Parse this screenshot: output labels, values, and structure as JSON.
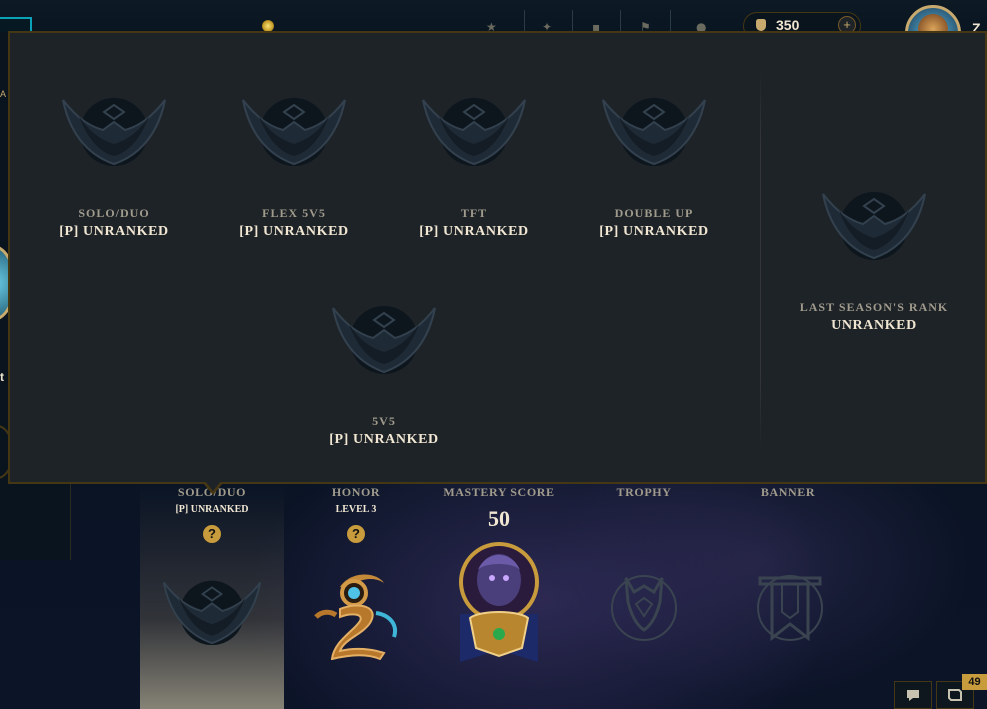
{
  "top_nav": {
    "currency_value": "350",
    "currency_add": "+",
    "summoner_name_partial": "Z"
  },
  "background_peek": {
    "left_text": "A",
    "left_text2": "t"
  },
  "ranked_popup": {
    "queues": [
      {
        "name": "SOLO/DUO",
        "rank": "[P] UNRANKED"
      },
      {
        "name": "FLEX 5V5",
        "rank": "[P] UNRANKED"
      },
      {
        "name": "TFT",
        "rank": "[P] UNRANKED"
      },
      {
        "name": "DOUBLE UP",
        "rank": "[P] UNRANKED"
      },
      {
        "name": "5V5",
        "rank": "[P] UNRANKED"
      }
    ],
    "last_season": {
      "name": "LAST SEASON'S RANK",
      "rank": "UNRANKED"
    }
  },
  "stats_row": {
    "solo_duo": {
      "title": "SOLO/DUO",
      "sub": "[P] UNRANKED",
      "help": "?"
    },
    "honor": {
      "title": "HONOR",
      "sub": "LEVEL 3",
      "help": "?"
    },
    "mastery": {
      "title": "MASTERY SCORE",
      "value": "50"
    },
    "trophy": {
      "title": "TROPHY"
    },
    "banner": {
      "title": "BANNER"
    }
  },
  "social": {
    "notification_count": "49"
  },
  "icons": {
    "rank_crest": "unranked-crest-icon",
    "honor": "honor-level-emblem",
    "trophy": "trophy-icon",
    "banner": "banner-icon",
    "chat": "chat-icon",
    "mission": "mission-icon",
    "currency": "blue-essence-icon"
  },
  "colors": {
    "gold": "#c8aa6e",
    "gold_dark": "#463714",
    "text_light": "#f0e6d2",
    "text_muted": "#a09b8c",
    "popup_bg": "#1e2328",
    "accent_cyan": "#0aa2b8"
  }
}
